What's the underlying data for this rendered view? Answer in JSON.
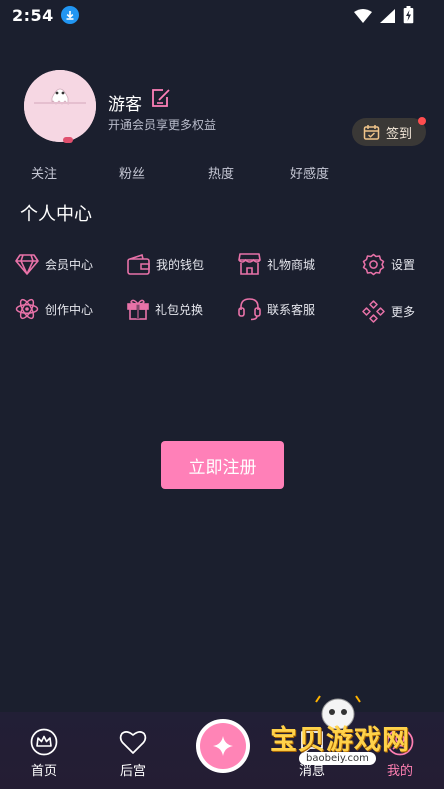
{
  "status_bar": {
    "time": "2:54"
  },
  "profile": {
    "username": "游客",
    "subtitle": "开通会员享更多权益",
    "checkin_label": "签到"
  },
  "stats": [
    "关注",
    "粉丝",
    "热度",
    "好感度"
  ],
  "section_title": "个人中心",
  "menu": [
    {
      "label": "会员中心",
      "icon": "diamond-icon"
    },
    {
      "label": "我的钱包",
      "icon": "wallet-icon"
    },
    {
      "label": "礼物商城",
      "icon": "store-icon"
    },
    {
      "label": "设置",
      "icon": "gear-icon"
    },
    {
      "label": "创作中心",
      "icon": "atom-icon"
    },
    {
      "label": "礼包兑换",
      "icon": "gift-icon"
    },
    {
      "label": "联系客服",
      "icon": "headset-icon"
    },
    {
      "label": "更多",
      "icon": "more-diamonds-icon"
    }
  ],
  "register_label": "立即注册",
  "bottom_nav": [
    {
      "label": "首页",
      "icon": "crown-icon"
    },
    {
      "label": "后宫",
      "icon": "heart-icon"
    },
    {
      "label": "",
      "icon": "sparkle-icon"
    },
    {
      "label": "消息",
      "icon": "message-icon"
    },
    {
      "label": "我的",
      "icon": "user-icon"
    }
  ],
  "watermark": {
    "title": "宝贝游戏网",
    "url": "baobeiy.com"
  },
  "colors": {
    "background": "#1b1f2e",
    "accent_pink": "#ff80b8",
    "menu_icon_pink": "#e872a8"
  }
}
